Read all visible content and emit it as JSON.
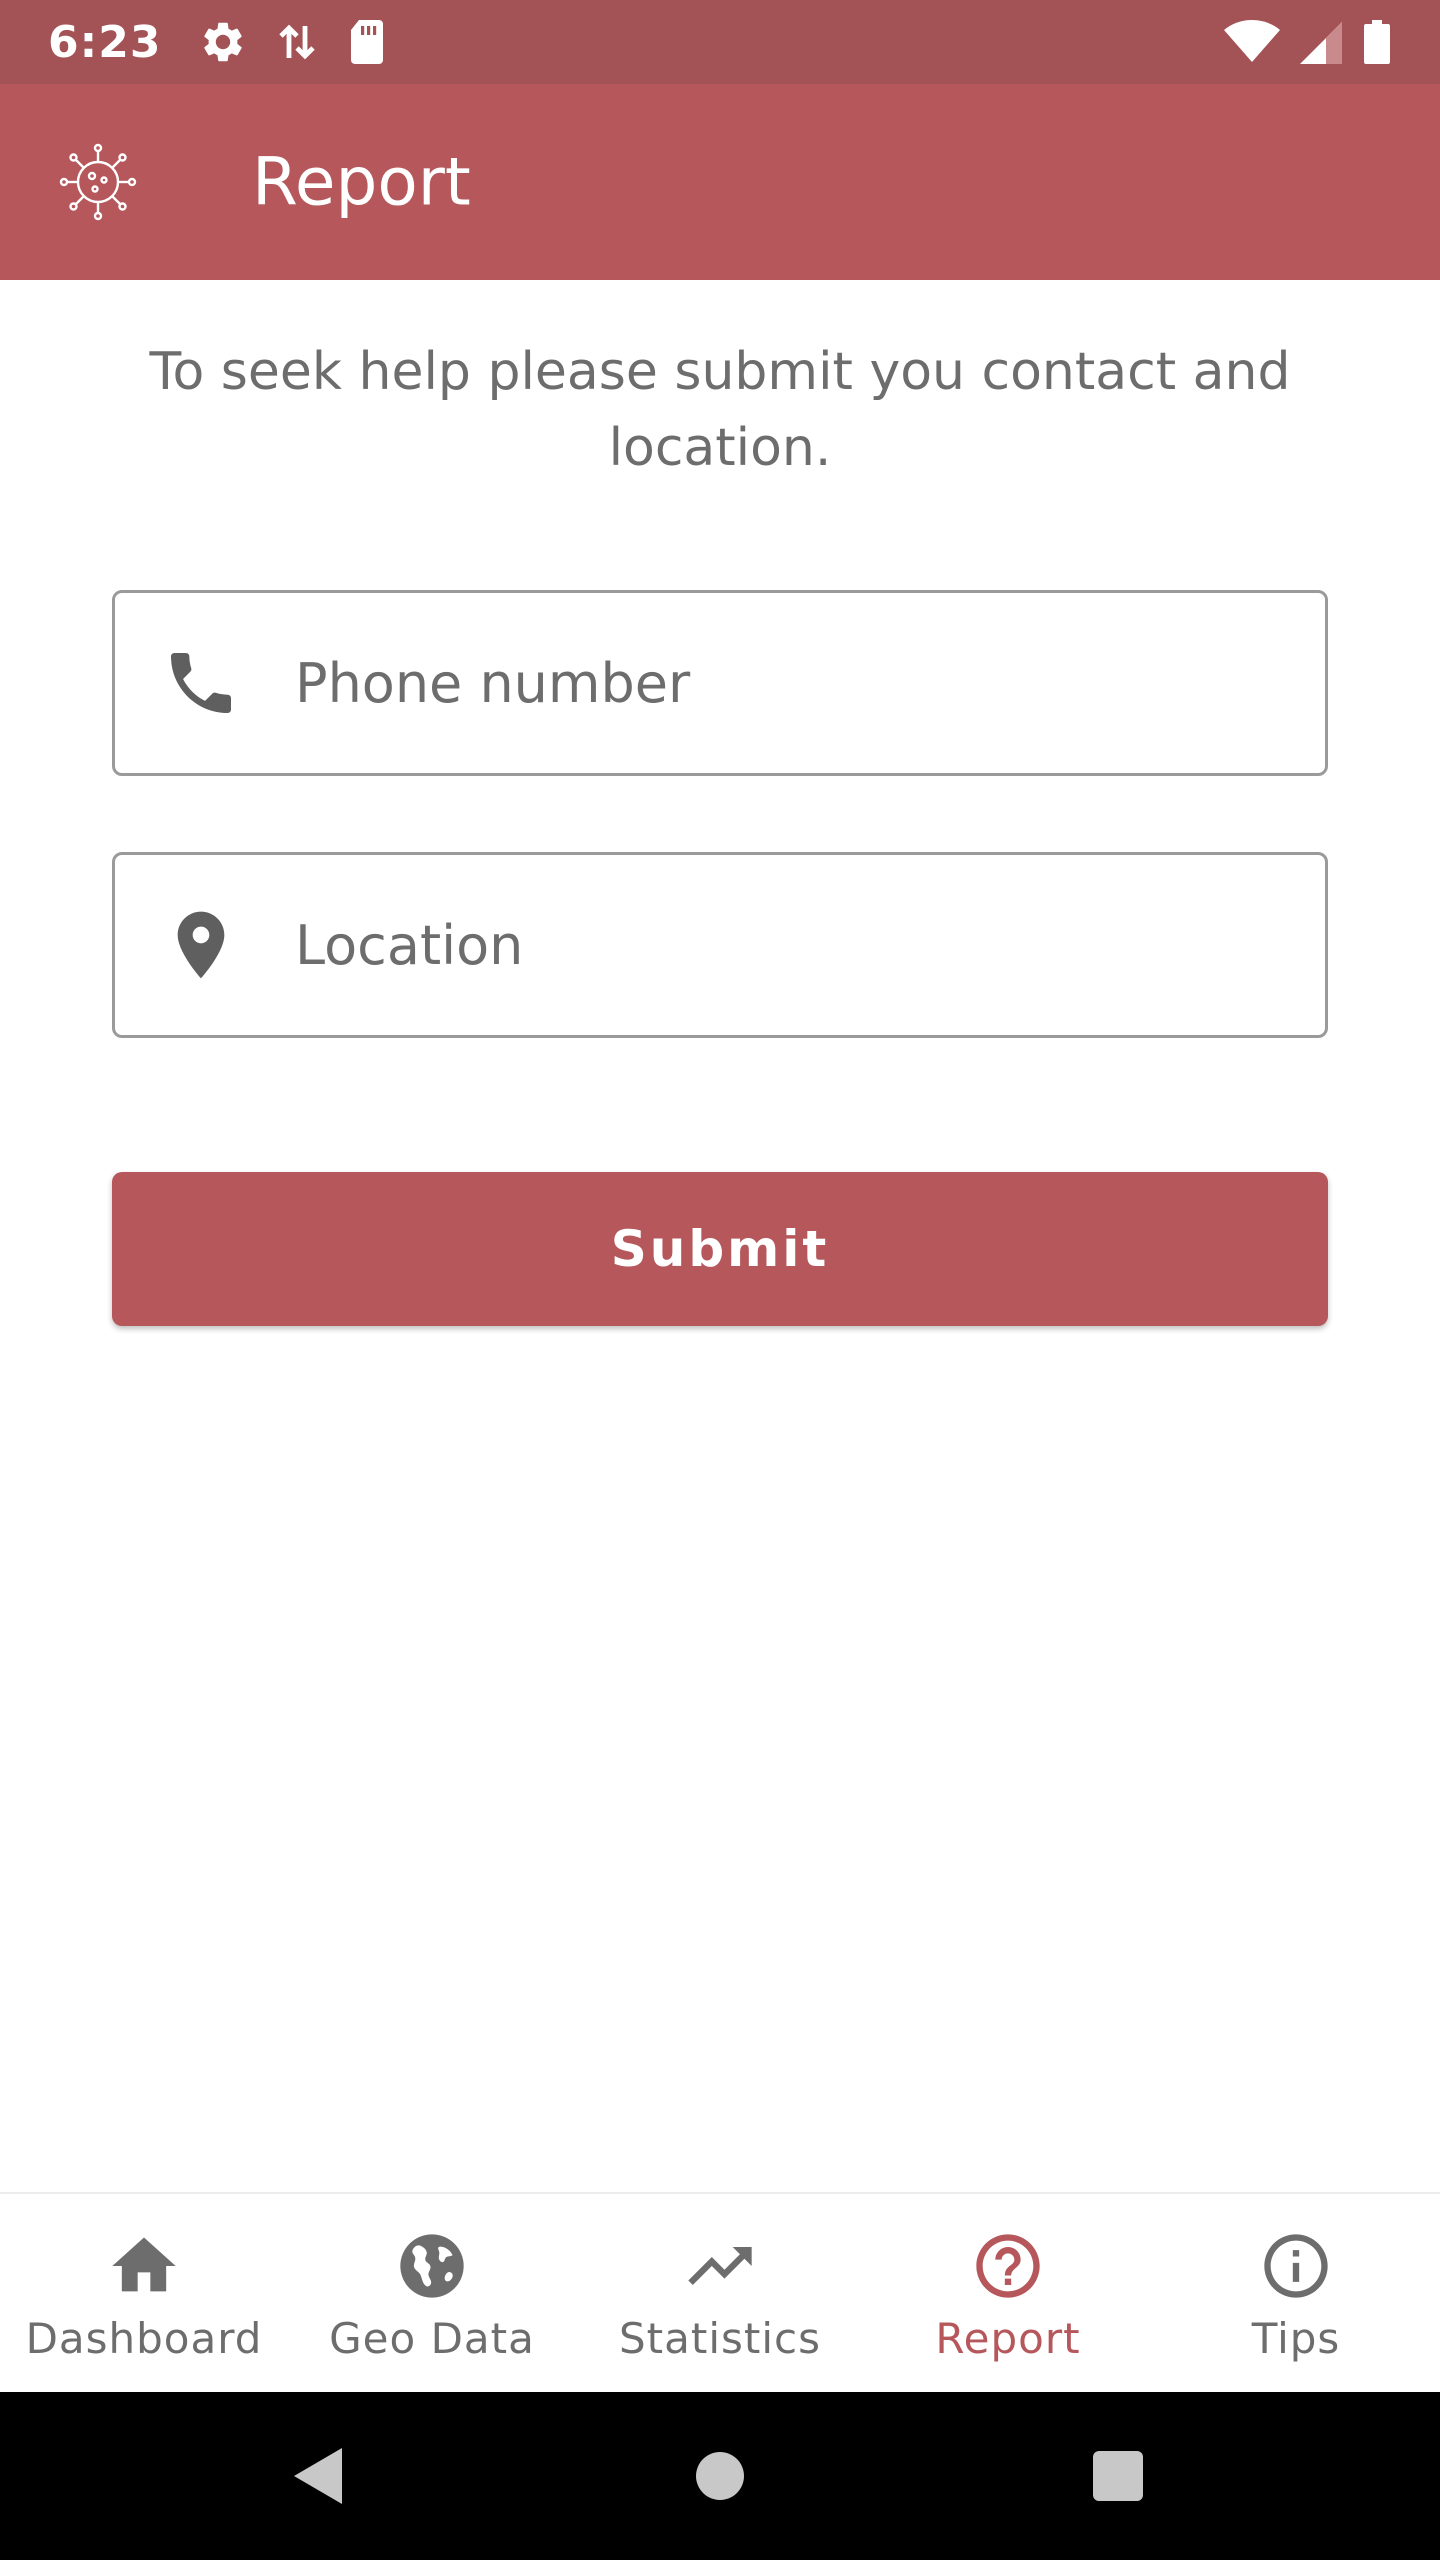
{
  "status_bar": {
    "time": "6:23",
    "icons": [
      "gear-icon",
      "data-transfer-icon",
      "sd-card-icon",
      "wifi-icon",
      "cell-signal-icon",
      "battery-icon"
    ]
  },
  "app_bar": {
    "title": "Report",
    "logo_icon": "virus-icon"
  },
  "main": {
    "intro": "To seek help please submit you contact and location.",
    "phone_field": {
      "placeholder": "Phone number",
      "value": "",
      "icon": "phone-icon"
    },
    "location_field": {
      "placeholder": "Location",
      "value": "",
      "icon": "location-pin-icon"
    },
    "submit_label": "Submit"
  },
  "bottom_nav": {
    "items": [
      {
        "label": "Dashboard",
        "icon": "home-icon",
        "active": false
      },
      {
        "label": "Geo Data",
        "icon": "globe-icon",
        "active": false
      },
      {
        "label": "Statistics",
        "icon": "trending-up-icon",
        "active": false
      },
      {
        "label": "Report",
        "icon": "help-circle-icon",
        "active": true
      },
      {
        "label": "Tips",
        "icon": "info-icon",
        "active": false
      }
    ]
  },
  "colors": {
    "primary": "#b5575b",
    "status_bar": "#a35256",
    "text_muted": "#6d6d6d"
  }
}
